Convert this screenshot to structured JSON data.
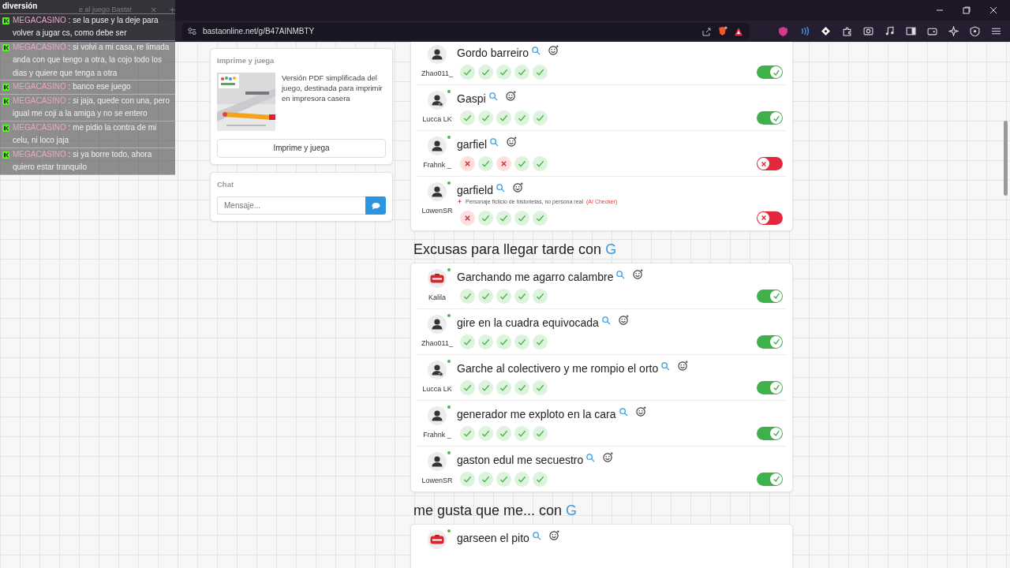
{
  "browser": {
    "tab": {
      "title": "e al juego Basta!",
      "close": "×",
      "new_tab": "+"
    },
    "url": "bastaonline.net/g/B47AINMBTY"
  },
  "overlay_chat": {
    "messages": [
      {
        "text": "diversión"
      },
      {
        "user": "MEGACASINO",
        "text": ": se la puse y la deje para volver a jugar cs, como debe ser"
      },
      {
        "user": "MEGACASINO",
        "text": ": si volvi a mi casa, re limada anda con que tengo a otra, la cojo todo los dias y quiere que tenga a otra"
      },
      {
        "user": "MEGACASINO",
        "text": ": banco ese juego"
      },
      {
        "user": "MEGACASINO",
        "text": ": si jaja, quede con una, pero igual me coji a la amiga y no se entero"
      },
      {
        "user": "MEGACASINO",
        "text": ": me pidio la contra de mi celu, ni loco jaja"
      },
      {
        "user": "MEGACASINO",
        "text": ": si ya borre todo, ahora quiero estar tranquilo"
      }
    ]
  },
  "sidebar": {
    "print_card": {
      "title": "Imprime y juega",
      "description": "Versión PDF simplificada del juego, destinada para imprimir en impresora casera",
      "button": "Imprime y juega"
    },
    "chat_card": {
      "title": "Chat",
      "placeholder": "Mensaje..."
    }
  },
  "sections": [
    {
      "answers": [
        {
          "player": "Zhao011_",
          "kind": "user",
          "text": "Gordo barreiro",
          "votes": [
            true,
            true,
            true,
            true,
            true
          ],
          "valid": true
        },
        {
          "player": "Lucca LK",
          "kind": "user-star",
          "online": true,
          "text": "Gaspi",
          "votes": [
            true,
            true,
            true,
            true,
            true
          ],
          "valid": true
        },
        {
          "player": "Frahnk _",
          "kind": "user",
          "online": true,
          "text": "garfiel",
          "votes": [
            false,
            true,
            false,
            true,
            true
          ],
          "valid": false
        },
        {
          "player": "LowenSR",
          "kind": "user",
          "online": true,
          "text": "garfield",
          "note": {
            "text": "Personaje ficticio de historietas, no persona real",
            "source": "(AI Checker)"
          },
          "votes": [
            false,
            true,
            true,
            true,
            true
          ],
          "valid": false
        }
      ]
    },
    {
      "title": "Excusas para llegar tarde con",
      "letter": "G",
      "answers": [
        {
          "player": "Kalila",
          "kind": "stop",
          "online": true,
          "text": "Garchando me agarro calambre",
          "votes": [
            true,
            true,
            true,
            true,
            true
          ],
          "valid": true
        },
        {
          "player": "Zhao011_",
          "kind": "user",
          "online": true,
          "text": "gire en la cuadra equivocada",
          "votes": [
            true,
            true,
            true,
            true,
            true
          ],
          "valid": true
        },
        {
          "player": "Lucca LK",
          "kind": "user-star",
          "online": true,
          "text": "Garche al colectivero y me rompio el orto",
          "votes": [
            true,
            true,
            true,
            true,
            true
          ],
          "valid": true
        },
        {
          "player": "Frahnk _",
          "kind": "user",
          "online": true,
          "text": "generador me exploto en la cara",
          "votes": [
            true,
            true,
            true,
            true,
            true
          ],
          "valid": true
        },
        {
          "player": "LowenSR",
          "kind": "user",
          "online": true,
          "text": "gaston edul me secuestro",
          "votes": [
            true,
            true,
            true,
            true,
            true
          ],
          "valid": true
        }
      ]
    },
    {
      "title": "me gusta que me... con",
      "letter": "G",
      "answers": [
        {
          "kind": "stop",
          "online": true,
          "text": "garseen el pito"
        }
      ]
    }
  ]
}
